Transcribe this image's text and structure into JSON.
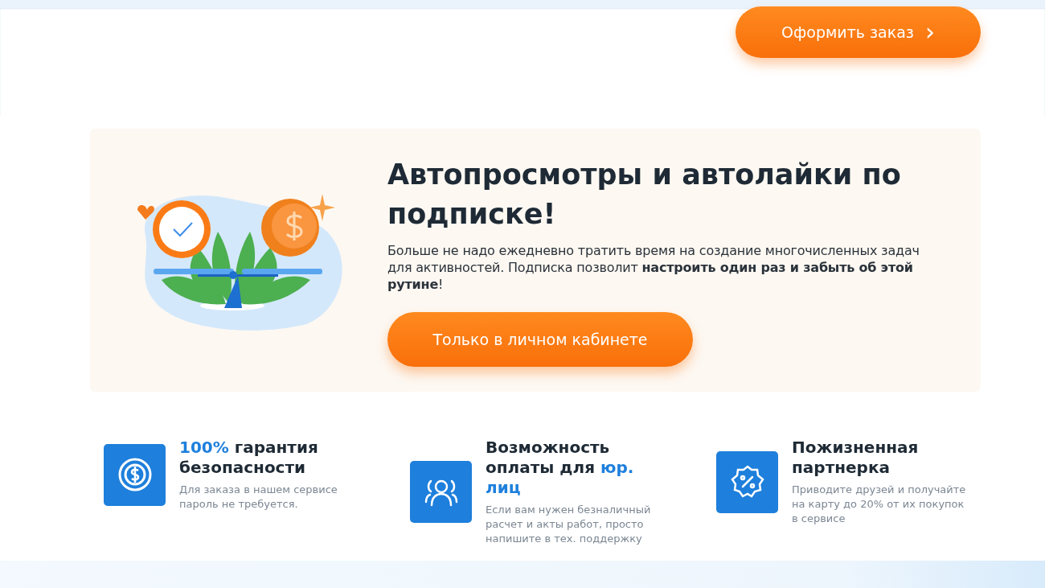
{
  "header": {
    "order_button": "Оформить заказ",
    "chevron": "›"
  },
  "promo": {
    "title": "Автопросмотры и автолайки по подписке!",
    "text": "Больше не надо ежедневно тратить время на создание многочисленных задач для активностей. Подписка позволит **настроить один раз и забыть об этой рутине**!",
    "button": "Только в личном кабинете"
  },
  "features": [
    {
      "title": "*100%* гарантия безопасности",
      "text": "Для заказа в нашем сервисе пароль не требуется."
    },
    {
      "title": "Возможность оплаты для *юр. лиц*",
      "text": "Если вам нужен безналичный расчет и акты работ, просто напишите в тех. поддержку"
    },
    {
      "title": "Пожизненная партнерка",
      "text": "Приводите друзей и получайте на карту до 20% от их покупок в сервисе"
    }
  ]
}
